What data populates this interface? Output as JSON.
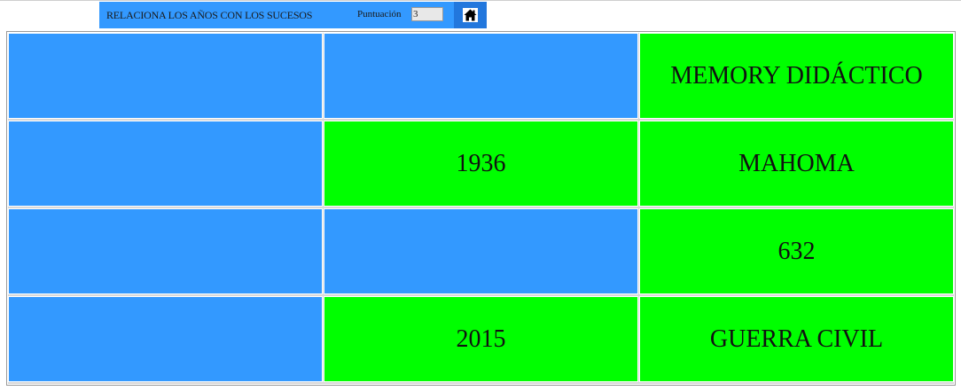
{
  "toolbar": {
    "title": "RELACIONA LOS AÑOS CON LOS SUCESOS",
    "score_label": "Puntuación",
    "score_value": "3",
    "home_icon": "home-icon"
  },
  "colors": {
    "hidden_card": "#3399ff",
    "revealed_card": "#00ff00",
    "toolbar": "#3399ff",
    "home_button": "#2277dd"
  },
  "board": {
    "cards": [
      {
        "text": "",
        "state": "hidden"
      },
      {
        "text": "",
        "state": "hidden"
      },
      {
        "text": "MEMORY DIDÁCTICO",
        "state": "revealed"
      },
      {
        "text": "",
        "state": "hidden"
      },
      {
        "text": "1936",
        "state": "revealed"
      },
      {
        "text": "MAHOMA",
        "state": "revealed"
      },
      {
        "text": "",
        "state": "hidden"
      },
      {
        "text": "",
        "state": "hidden"
      },
      {
        "text": "632",
        "state": "revealed"
      },
      {
        "text": "",
        "state": "hidden"
      },
      {
        "text": "2015",
        "state": "revealed"
      },
      {
        "text": "GUERRA CIVIL",
        "state": "revealed"
      }
    ]
  }
}
